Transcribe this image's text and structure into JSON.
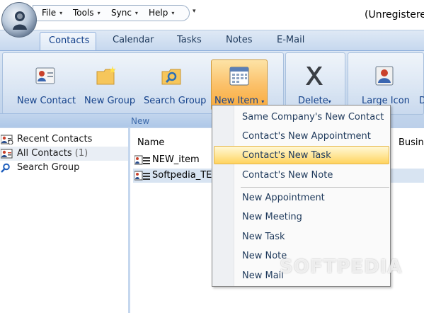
{
  "menu": {
    "file": "File",
    "tools": "Tools",
    "sync": "Sync",
    "help": "Help"
  },
  "window_title": "(Unregistere",
  "tabs": [
    "Contacts",
    "Calendar",
    "Tasks",
    "Notes",
    "E-Mail"
  ],
  "ribbon": {
    "buttons": {
      "new_contact": "New Contact",
      "new_group": "New Group",
      "search_group": "Search Group",
      "new_item": "New Item",
      "delete": "Delete",
      "large_icon": "Large Icon",
      "next_truncated": "D"
    },
    "group_label": "New"
  },
  "nav": {
    "recent": "Recent Contacts",
    "all": "All Contacts",
    "all_count": "(1)",
    "search": "Search Group"
  },
  "list": {
    "headers": {
      "name": "Name",
      "business": "Busine"
    },
    "rows": [
      "NEW_item",
      "Softpedia_TE"
    ]
  },
  "dropdown": {
    "items": [
      "Same Company's New Contact",
      "Contact's New Appointment",
      "Contact's New Task",
      "Contact's New Note",
      "New Appointment",
      "New Meeting",
      "New Task",
      "New Note",
      "New Mail"
    ]
  },
  "watermark": "SOFTPEDIA",
  "colors": {
    "accent": "#15428b",
    "ribbon": "#c7d8ed",
    "highlight": "#ffe79c"
  }
}
